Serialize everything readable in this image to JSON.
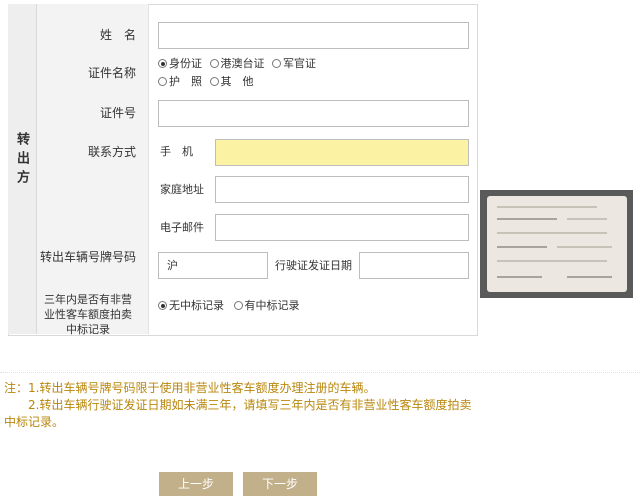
{
  "side_title": "转出方",
  "fields": {
    "name_label": "姓　名",
    "id_type_label": "证件名称",
    "id_types": [
      "身份证",
      "港澳台证",
      "军官证",
      "护　照",
      "其　他"
    ],
    "id_no_label": "证件号",
    "contact_label": "联系方式",
    "mobile_label": "手　机",
    "home_phone_label": "家庭地址",
    "email_label": "电子邮件",
    "plate_label": "转出车辆号牌号码",
    "plate_value": "沪",
    "license_date_label": "行驶证发证日期",
    "record_label": "三年内是否有非营业性客车额度拍卖中标记录",
    "record_options": [
      "无中标记录",
      "有中标记录"
    ]
  },
  "notes": {
    "line1": "注：1.转出车辆号牌号码限于使用非营业性客车额度办理注册的车辆。",
    "line2": "　　2.转出车辆行驶证发证日期如未满三年，请填写三年内是否有非营业性客车额度拍卖中标记录。"
  },
  "buttons": {
    "prev": "上一步",
    "next": "下一步"
  },
  "colors": {
    "accent": "#c2b08a",
    "highlight": "#fbf3a3",
    "note": "#b8860b"
  },
  "icons": [
    "radio-icon"
  ]
}
